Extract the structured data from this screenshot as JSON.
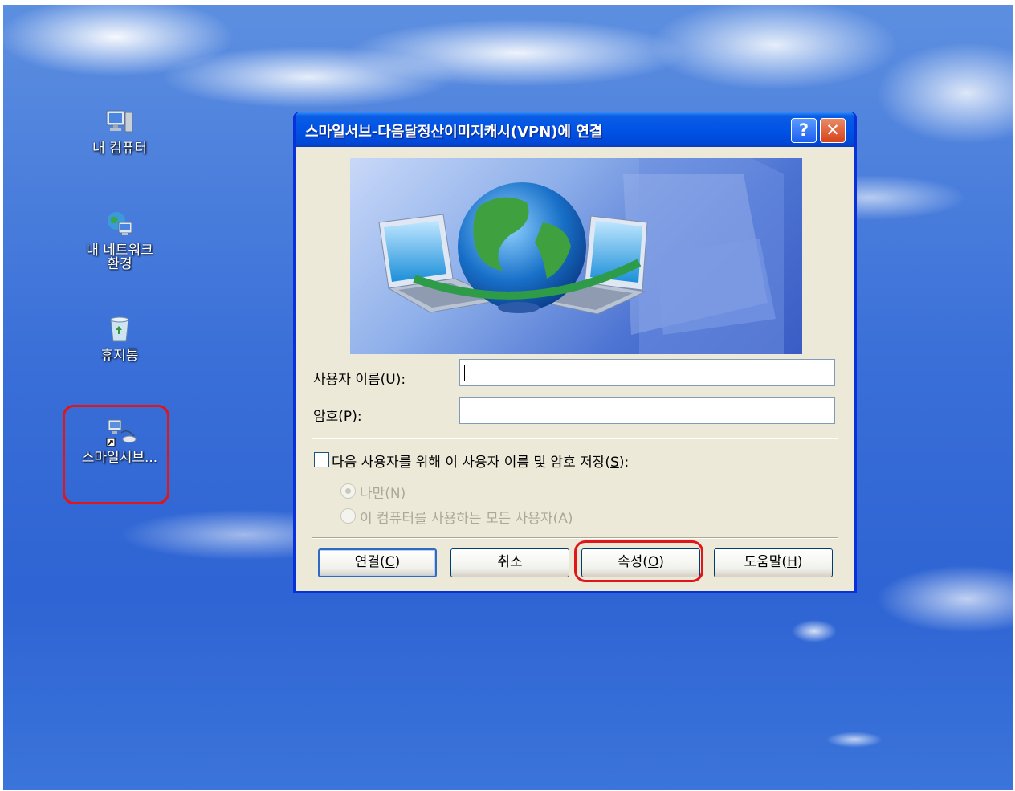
{
  "desktop": {
    "icons": [
      {
        "label": "내 컴퓨터",
        "icon": "my-computer-icon"
      },
      {
        "label_line1": "내 네트워크",
        "label_line2": "환경",
        "icon": "network-places-icon"
      },
      {
        "label": "휴지통",
        "icon": "recycle-bin-icon"
      },
      {
        "label": "스마일서브...",
        "icon": "vpn-shortcut-icon"
      }
    ]
  },
  "dialog": {
    "title": "스마일서브-다음달정산이미지캐시(VPN)에 연결",
    "help_glyph": "?",
    "close_glyph": "✕",
    "username": {
      "label_pre": "사용자 이름(",
      "label_key": "U",
      "label_post": "):",
      "value": ""
    },
    "password": {
      "label_pre": "암호(",
      "label_key": "P",
      "label_post": "):",
      "value": ""
    },
    "save_checkbox": {
      "label_pre": "다음 사용자를 위해 이 사용자 이름 및 암호 저장(",
      "label_key": "S",
      "label_post": "):",
      "checked": false
    },
    "radio_me": {
      "label_pre": "나만(",
      "label_key": "N",
      "label_post": ")",
      "checked": true,
      "disabled": true
    },
    "radio_all": {
      "label_pre": "이 컴퓨터를 사용하는 모든 사용자(",
      "label_key": "A",
      "label_post": ")",
      "checked": false,
      "disabled": true
    },
    "buttons": {
      "connect": {
        "pre": "연결(",
        "key": "C",
        "post": ")"
      },
      "cancel": {
        "label": "취소"
      },
      "properties": {
        "pre": "속성(",
        "key": "O",
        "post": ")"
      },
      "help": {
        "pre": "도움말(",
        "key": "H",
        "post": ")"
      }
    }
  },
  "colors": {
    "highlight": "#e0161b",
    "titlebar": "#0054e6",
    "dialog_bg": "#ece9d8"
  }
}
